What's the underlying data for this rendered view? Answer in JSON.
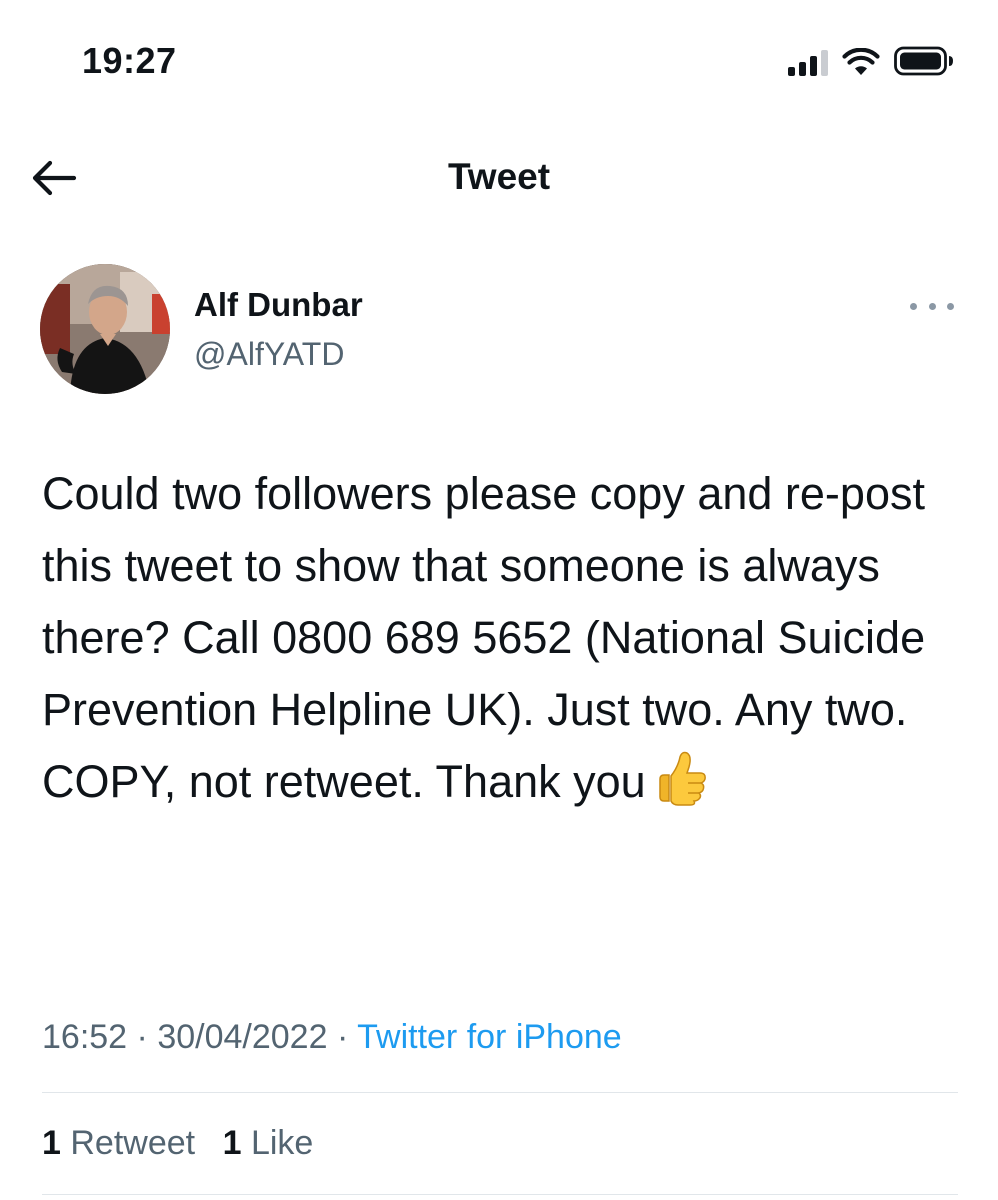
{
  "status_bar": {
    "time": "19:27",
    "icons": [
      "signal-icon",
      "wifi-icon",
      "battery-icon"
    ]
  },
  "header": {
    "title": "Tweet",
    "back_icon": "arrow-left-icon"
  },
  "tweet": {
    "author_name": "Alf Dunbar",
    "author_handle": "@AlfYATD",
    "more_icon": "more-horizontal-icon",
    "text": "Could two followers please copy and re-post this tweet to show that someone is always there? Call 0800 689 5652 (National Suicide Prevention Helpline UK). Just two. Any two. COPY, not retweet. Thank you",
    "emoji": "thumbs-up",
    "time": "16:52",
    "date": "30/04/2022",
    "separator": "·",
    "source": "Twitter for iPhone"
  },
  "engagement": {
    "retweet_count": "1",
    "retweet_label": "Retweet",
    "like_count": "1",
    "like_label": "Like"
  },
  "colors": {
    "text": "#0f1419",
    "secondary": "#536471",
    "link": "#1d9bf0",
    "divider": "#e1e6ea"
  }
}
